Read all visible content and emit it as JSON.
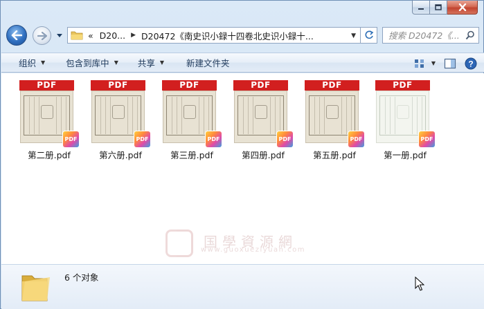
{
  "window": {
    "minimize_icon": "minimize-icon",
    "maximize_icon": "maximize-icon",
    "close_icon": "close-icon"
  },
  "nav": {
    "back_icon": "back-arrow-icon",
    "forward_icon": "forward-arrow-icon",
    "address": {
      "overflow": "«",
      "crumb1": "D20...",
      "crumb2": "D20472《南史识小録十四卷北史识小録十..."
    },
    "search_placeholder": "搜索 D20472《..."
  },
  "toolbar": {
    "organize": "组织",
    "include_in_library": "包含到库中",
    "share": "共享",
    "new_folder": "新建文件夹"
  },
  "files": [
    {
      "name": "第二册.pdf",
      "badge": "PDF",
      "thumb": "dark"
    },
    {
      "name": "第六册.pdf",
      "badge": "PDF",
      "thumb": "dark"
    },
    {
      "name": "第三册.pdf",
      "badge": "PDF",
      "thumb": "dark"
    },
    {
      "name": "第四册.pdf",
      "badge": "PDF",
      "thumb": "dark"
    },
    {
      "name": "第五册.pdf",
      "badge": "PDF",
      "thumb": "dark"
    },
    {
      "name": "第一册.pdf",
      "badge": "PDF",
      "thumb": "light"
    }
  ],
  "watermark": {
    "text": "国學資源網",
    "url": "www.guoxueziyuan.com"
  },
  "status": {
    "count_text": "6 个对象"
  },
  "colors": {
    "pdf_band": "#d21f1f",
    "window_chrome": "#dbe9f7",
    "close_button": "#c24430"
  }
}
